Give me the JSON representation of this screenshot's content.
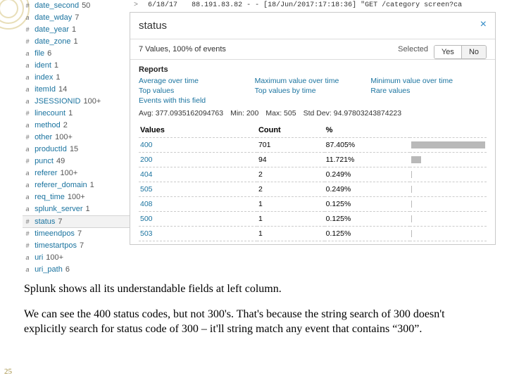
{
  "event": {
    "chevron": ">",
    "date": "6/18/17",
    "raw": "88.191.83.82 - - [18/Jun/2017:17:18:36] \"GET /category screen?ca"
  },
  "panel": {
    "title": "status",
    "summary": "7 Values, 100% of events",
    "selected_label": "Selected",
    "yes": "Yes",
    "no": "No",
    "reports_h": "Reports",
    "links1": [
      "Average over time",
      "Maximum value over time",
      "Minimum value over time"
    ],
    "links2": [
      "Top values",
      "Top values by time",
      "Rare values"
    ],
    "links3": "Events with this field",
    "stats": {
      "avg": "Avg: 377.0935162094763",
      "min": "Min: 200",
      "max": "Max: 505",
      "std": "Std Dev: 94.97803243874223"
    },
    "cols": [
      "Values",
      "Count",
      "%"
    ],
    "rows": [
      {
        "v": "400",
        "c": "701",
        "p": "87.405%",
        "w": 100
      },
      {
        "v": "200",
        "c": "94",
        "p": "11.721%",
        "w": 13
      },
      {
        "v": "404",
        "c": "2",
        "p": "0.249%",
        "w": 1
      },
      {
        "v": "505",
        "c": "2",
        "p": "0.249%",
        "w": 1
      },
      {
        "v": "408",
        "c": "1",
        "p": "0.125%",
        "w": 1
      },
      {
        "v": "500",
        "c": "1",
        "p": "0.125%",
        "w": 1
      },
      {
        "v": "503",
        "c": "1",
        "p": "0.125%",
        "w": 1
      }
    ]
  },
  "fields": [
    {
      "t": "#",
      "n": "date_second",
      "c": "50"
    },
    {
      "t": "a",
      "n": "date_wday",
      "c": "7"
    },
    {
      "t": "#",
      "n": "date_year",
      "c": "1"
    },
    {
      "t": "#",
      "n": "date_zone",
      "c": "1"
    },
    {
      "t": "a",
      "n": "file",
      "c": "6"
    },
    {
      "t": "a",
      "n": "ident",
      "c": "1"
    },
    {
      "t": "a",
      "n": "index",
      "c": "1"
    },
    {
      "t": "a",
      "n": "itemId",
      "c": "14"
    },
    {
      "t": "a",
      "n": "JSESSIONID",
      "c": "100+"
    },
    {
      "t": "#",
      "n": "linecount",
      "c": "1"
    },
    {
      "t": "a",
      "n": "method",
      "c": "2"
    },
    {
      "t": "#",
      "n": "other",
      "c": "100+"
    },
    {
      "t": "a",
      "n": "productId",
      "c": "15"
    },
    {
      "t": "#",
      "n": "punct",
      "c": "49"
    },
    {
      "t": "a",
      "n": "referer",
      "c": "100+"
    },
    {
      "t": "a",
      "n": "referer_domain",
      "c": "1"
    },
    {
      "t": "a",
      "n": "req_time",
      "c": "100+"
    },
    {
      "t": "a",
      "n": "splunk_server",
      "c": "1"
    },
    {
      "t": "#",
      "n": "status",
      "c": "7",
      "sel": true
    },
    {
      "t": "#",
      "n": "timeendpos",
      "c": "7"
    },
    {
      "t": "#",
      "n": "timestartpos",
      "c": "7"
    },
    {
      "t": "a",
      "n": "uri",
      "c": "100+"
    },
    {
      "t": "a",
      "n": "uri_path",
      "c": "6"
    }
  ],
  "caption": {
    "p1": "Splunk shows all its understandable fields at left column.",
    "p2": "We can see the 400 status codes, but not 300's. That's because the string search of 300 doesn't explicitly search for status code of 300 – it'll string match any event that contains “300”."
  },
  "page": "25"
}
